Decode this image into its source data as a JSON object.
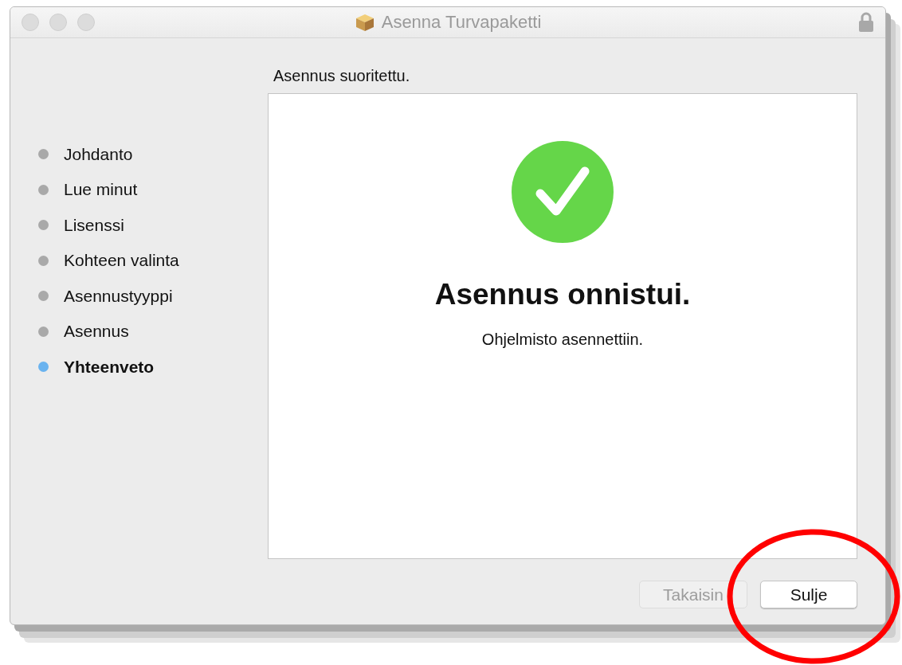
{
  "window": {
    "title": "Asenna Turvapaketti"
  },
  "steps": [
    {
      "label": "Johdanto",
      "selected": false
    },
    {
      "label": "Lue minut",
      "selected": false
    },
    {
      "label": "Lisenssi",
      "selected": false
    },
    {
      "label": "Kohteen valinta",
      "selected": false
    },
    {
      "label": "Asennustyyppi",
      "selected": false
    },
    {
      "label": "Asennus",
      "selected": false
    },
    {
      "label": "Yhteenveto",
      "selected": true
    }
  ],
  "heading": "Asennus suoritettu.",
  "result": {
    "title": "Asennus onnistui.",
    "message": "Ohjelmisto asennettiin."
  },
  "buttons": [
    {
      "label": "Takaisin",
      "disabled": true
    },
    {
      "label": "Sulje",
      "disabled": false
    }
  ]
}
